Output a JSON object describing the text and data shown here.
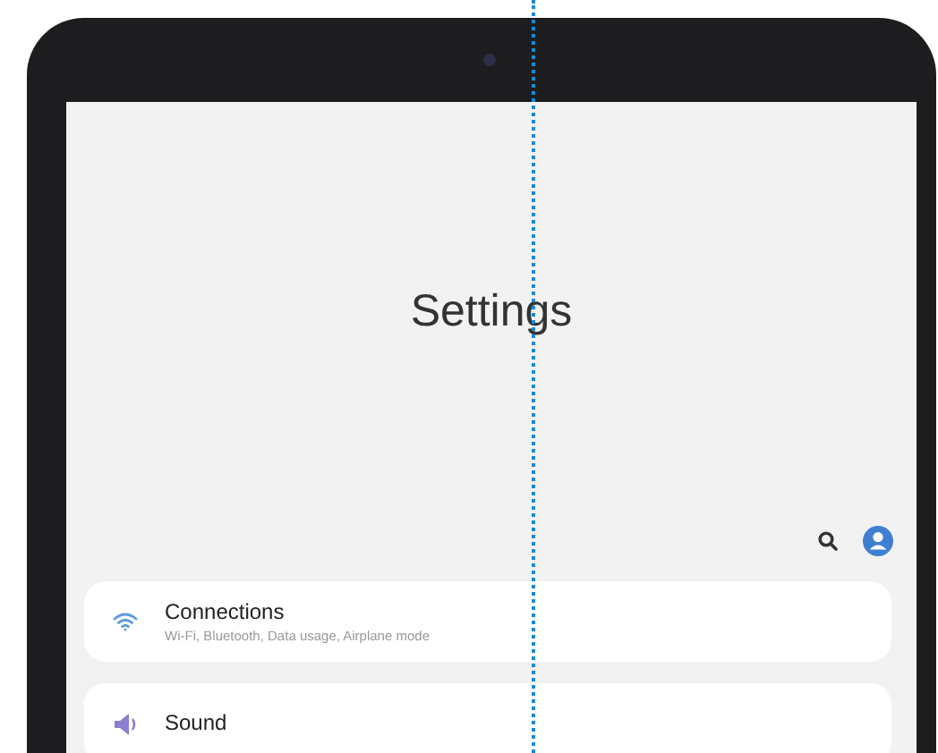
{
  "screen_title": "Settings",
  "items": [
    {
      "title": "Connections",
      "subtitle": "Wi-Fi, Bluetooth, Data usage, Airplane mode"
    },
    {
      "title": "Sound"
    }
  ]
}
